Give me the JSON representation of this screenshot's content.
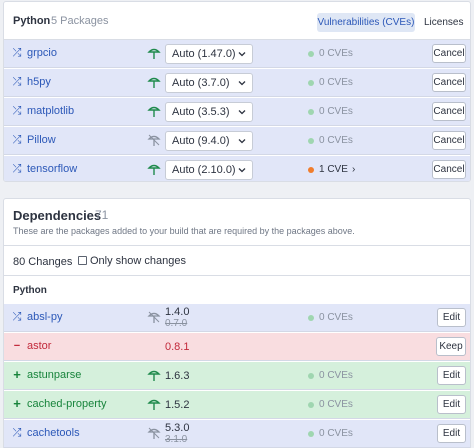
{
  "top": {
    "title": "Python",
    "count": "5 Packages",
    "tab_active": "Vulnerabilities (CVEs)",
    "tab_other": "Licenses",
    "rows": [
      {
        "name": "grpcio",
        "select": "Auto (1.47.0)",
        "cve": "0 CVEs",
        "button": "Cancel"
      },
      {
        "name": "h5py",
        "select": "Auto (3.7.0)",
        "cve": "0 CVEs",
        "button": "Cancel"
      },
      {
        "name": "matplotlib",
        "select": "Auto (3.5.3)",
        "cve": "0 CVEs",
        "button": "Cancel"
      },
      {
        "name": "Pillow",
        "select": "Auto (9.4.0)",
        "cve": "0 CVEs",
        "button": "Cancel"
      },
      {
        "name": "tensorflow",
        "select": "Auto (2.10.0)",
        "cve": "1 CVE",
        "button": "Cancel"
      }
    ]
  },
  "deps": {
    "title": "Dependencies",
    "count": "71",
    "description": "These are the packages added to your build that are required by the packages above.",
    "changes": "80 Changes",
    "only_show": "Only show changes",
    "section": "Python",
    "rows": [
      {
        "name": "absl-py",
        "version": "1.4.0",
        "old_version": "0.7.0",
        "cve": "0 CVEs",
        "button": "Edit"
      },
      {
        "name": "astor",
        "version": "0.8.1",
        "button": "Keep"
      },
      {
        "name": "astunparse",
        "version": "1.6.3",
        "cve": "0 CVEs",
        "button": "Edit"
      },
      {
        "name": "cached-property",
        "version": "1.5.2",
        "cve": "0 CVEs",
        "button": "Edit"
      },
      {
        "name": "cachetools",
        "version": "5.3.0",
        "old_version": "3.1.0",
        "cve": "0 CVEs",
        "button": "Edit"
      }
    ]
  },
  "colors": {
    "accent": "#2c58b8",
    "removed": "#c2293a",
    "added": "#18843c",
    "ok_dot": "#9fd6b0",
    "warn_dot": "#f07d2c"
  },
  "icons": {
    "changed": "shuffle-icon",
    "removed": "minus-icon",
    "added": "plus-icon",
    "tree": "tree-icon",
    "tree_muted": "tree-muted-icon",
    "dropdown": "chevron-down-icon",
    "more": "chevron-right-icon"
  }
}
